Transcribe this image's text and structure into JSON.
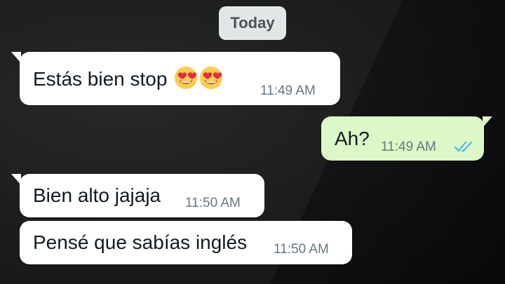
{
  "date_chip": {
    "label": "Today"
  },
  "messages": [
    {
      "direction": "incoming",
      "text": "Estás bien stop",
      "emoji": [
        "heart-eyes",
        "heart-eyes"
      ],
      "time": "11:49 AM"
    },
    {
      "direction": "outgoing",
      "text": "Ah?",
      "time": "11:49 AM",
      "status": "read-double-check"
    },
    {
      "direction": "incoming",
      "text": "Bien alto jajaja",
      "time": "11:50 AM"
    },
    {
      "direction": "incoming",
      "text": "Pensé que sabías inglés",
      "time": "11:50 AM"
    }
  ],
  "colors": {
    "incoming_bubble": "#ffffff",
    "outgoing_bubble": "#dcf8c6",
    "read_ticks": "#53bdeb",
    "timestamp": "#667781"
  }
}
